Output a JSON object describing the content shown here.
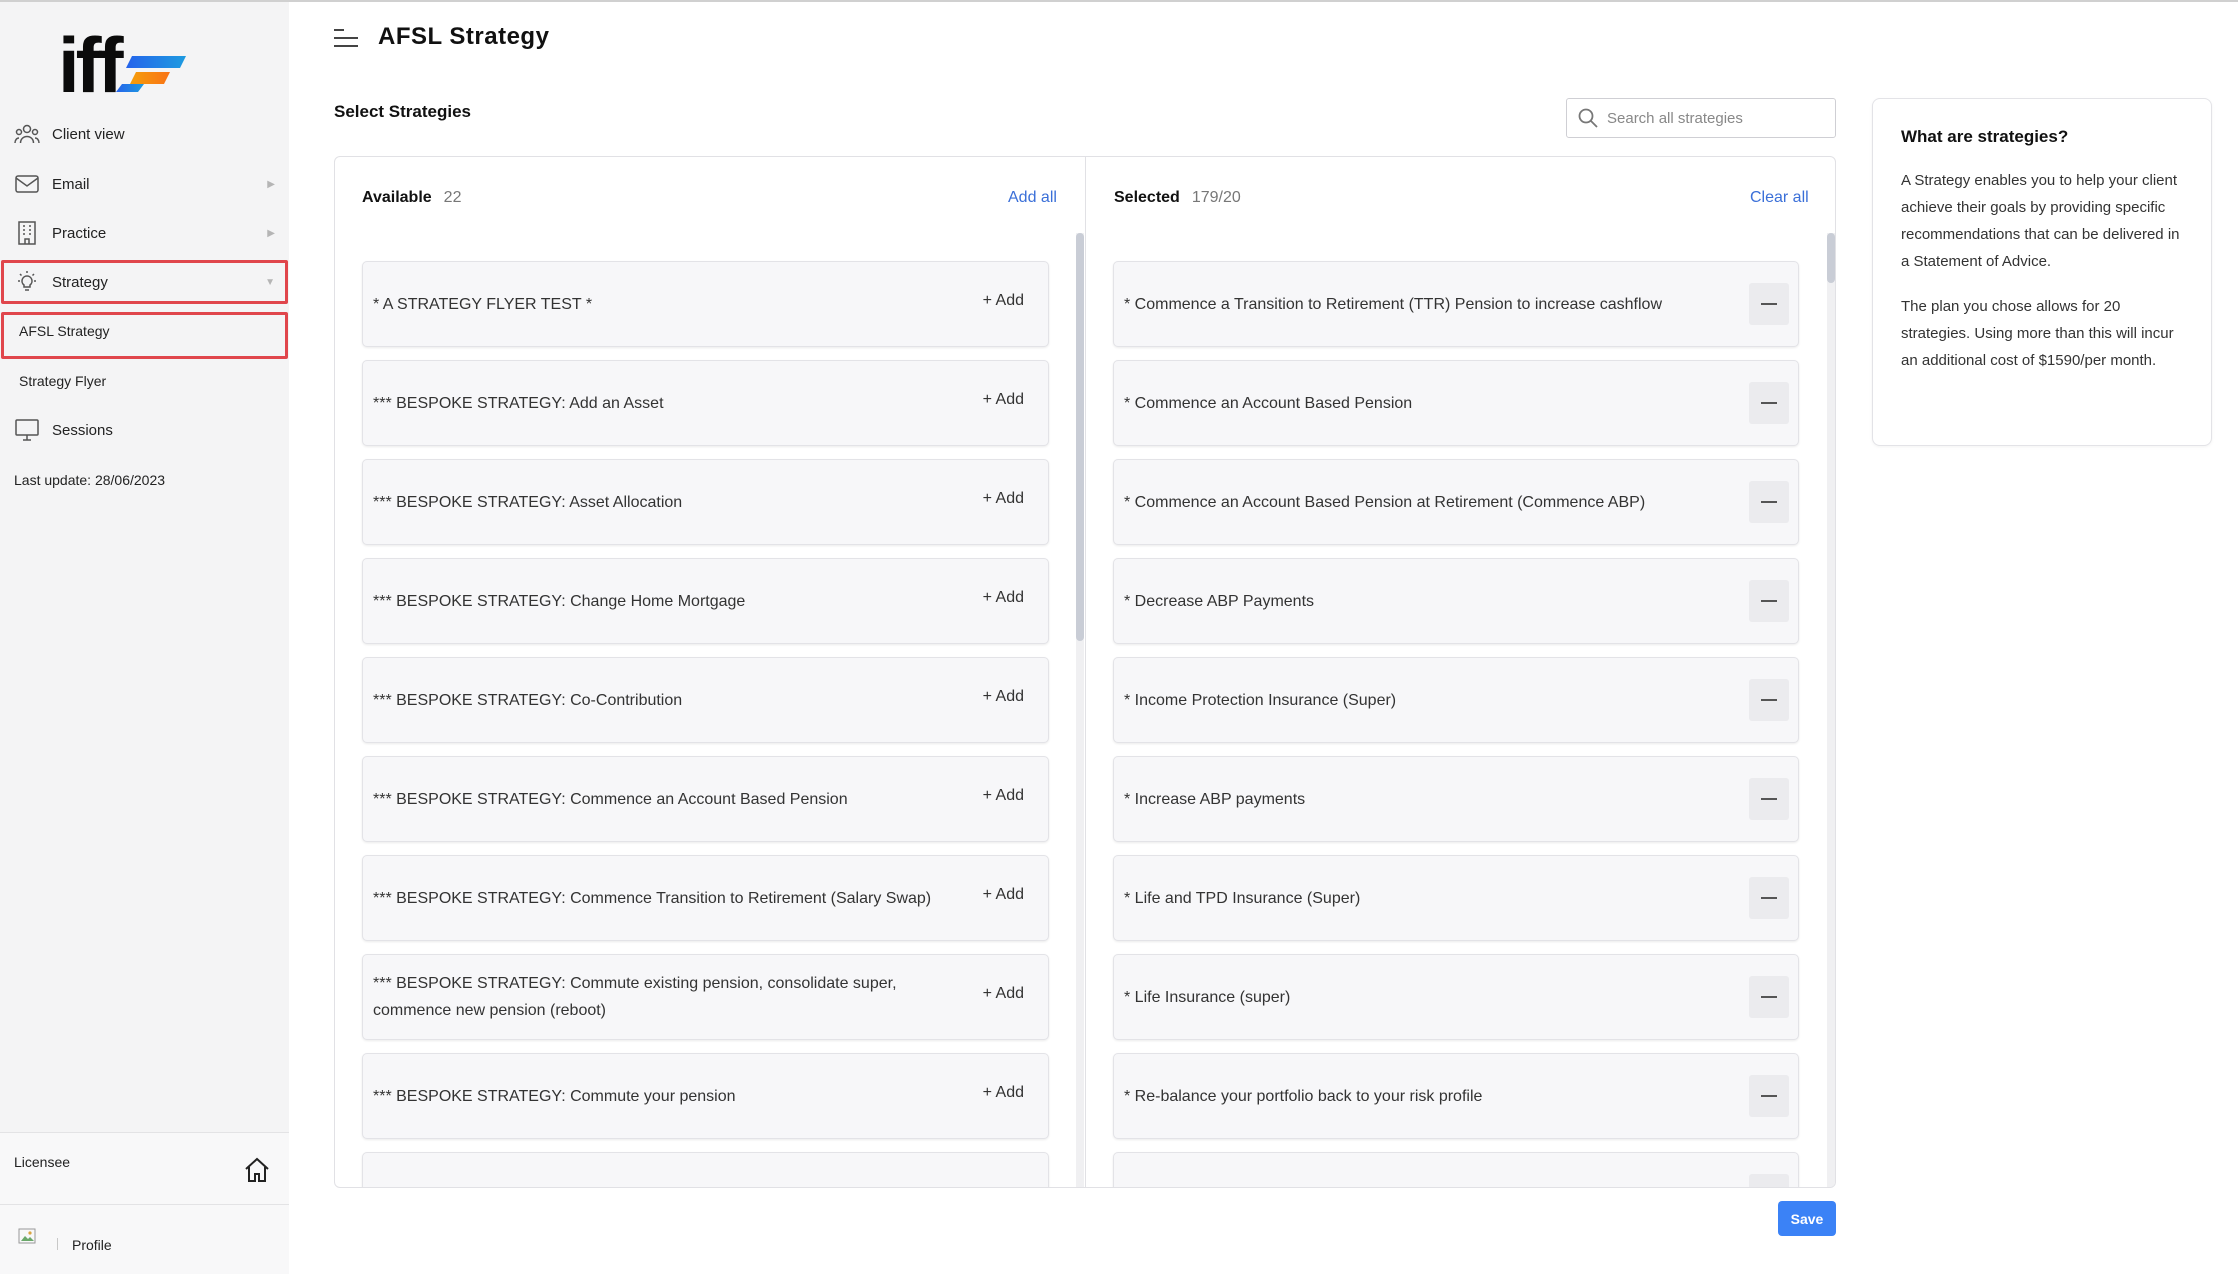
{
  "colors": {
    "accent": "#3a6fd8",
    "highlight": "#e0464c",
    "save": "#3b82f6",
    "sidebar_bg": "#f4f4f5"
  },
  "sidebar": {
    "logo_text": "iff",
    "items": [
      {
        "label": "Client view",
        "icon": "users-icon"
      },
      {
        "label": "Email",
        "icon": "mail-icon"
      },
      {
        "label": "Practice",
        "icon": "building-icon"
      },
      {
        "label": "Strategy",
        "icon": "lightbulb-icon"
      },
      {
        "label": "Sessions",
        "icon": "monitor-icon"
      }
    ],
    "sub_items": [
      {
        "label": "AFSL Strategy"
      },
      {
        "label": "Strategy Flyer"
      }
    ],
    "last_update": "Last update: 28/06/2023",
    "licensee": "Licensee",
    "profile": "Profile"
  },
  "header": {
    "title": "AFSL Strategy"
  },
  "main": {
    "section_title": "Select Strategies",
    "search": {
      "placeholder": "Search all strategies"
    },
    "available": {
      "label": "Available",
      "count": "22",
      "add_all": "Add all",
      "add_label": "+ Add",
      "items": [
        "* A STRATEGY FLYER TEST *",
        "*** BESPOKE STRATEGY: Add an Asset",
        "*** BESPOKE STRATEGY: Asset Allocation",
        "*** BESPOKE STRATEGY: Change Home Mortgage",
        "*** BESPOKE STRATEGY: Co-Contribution",
        "*** BESPOKE STRATEGY: Commence an Account Based Pension",
        "*** BESPOKE STRATEGY: Commence Transition to Retirement (Salary Swap)",
        "*** BESPOKE STRATEGY: Commute existing pension, consolidate super, commence new pension (reboot)",
        "*** BESPOKE STRATEGY: Commute your pension"
      ]
    },
    "selected": {
      "label": "Selected",
      "count": "179/20",
      "clear_all": "Clear all",
      "items": [
        "* Commence a Transition to Retirement (TTR) Pension to increase cashflow",
        "* Commence an Account Based Pension",
        "* Commence an Account Based Pension at Retirement (Commence ABP)",
        "* Decrease ABP Payments",
        "* Income Protection Insurance (Super)",
        "* Increase ABP payments",
        "* Life and TPD Insurance (Super)",
        "* Life Insurance (super)",
        "* Re-balance your portfolio back to your risk profile"
      ]
    },
    "save_label": "Save"
  },
  "info": {
    "title": "What are strategies?",
    "p1": "A Strategy enables you to help your client achieve their goals by providing specific recommendations that can be delivered in a Statement of Advice.",
    "p2": "The plan you chose allows for 20 strategies. Using more than this will incur an additional cost of $1590/per month."
  }
}
